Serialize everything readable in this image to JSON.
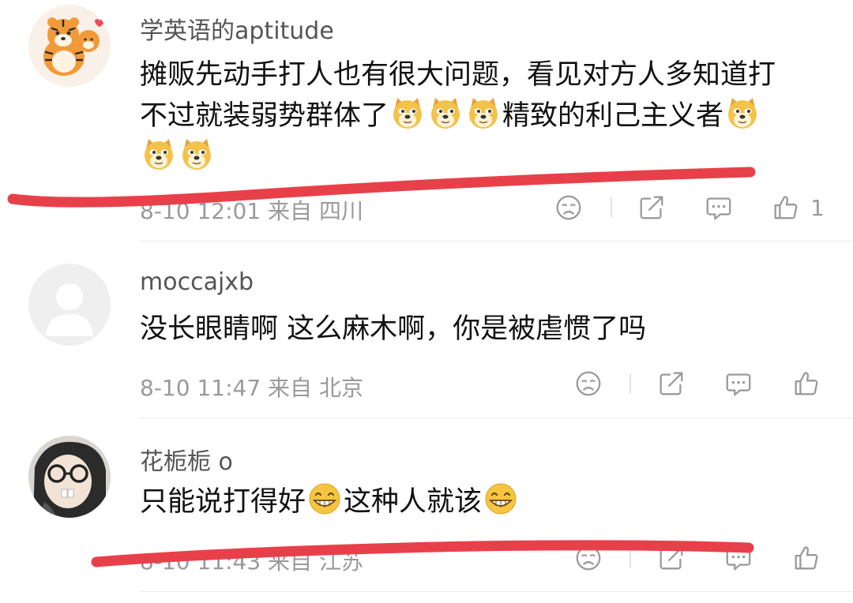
{
  "comments": [
    {
      "username": "学英语的aptitude",
      "line1": "摊贩先动手打人也有很大问题，看见对方人多知道打",
      "line2a": "不过就装弱势群体了",
      "line2b": "精致的利己主义者",
      "meta": "8-10 12:01 来自 四川",
      "like_count": "1"
    },
    {
      "username": "moccajxb",
      "line1": "没长眼睛啊 这么麻木啊，你是被虐惯了吗",
      "meta": "8-10 11:47 来自 北京"
    },
    {
      "username": "花栀栀 o",
      "line1a": "只能说打得好",
      "line1b": "这种人就该",
      "meta": "8-10 11:43 来自 江苏"
    }
  ],
  "colors": {
    "username": "#555555",
    "text": "#111111",
    "meta": "#9a9a9a",
    "annotation_red": "#e8404a"
  },
  "icons": [
    "dislike-icon",
    "share-icon",
    "reply-icon",
    "like-icon",
    "doge-emoji",
    "grin-emoji"
  ]
}
